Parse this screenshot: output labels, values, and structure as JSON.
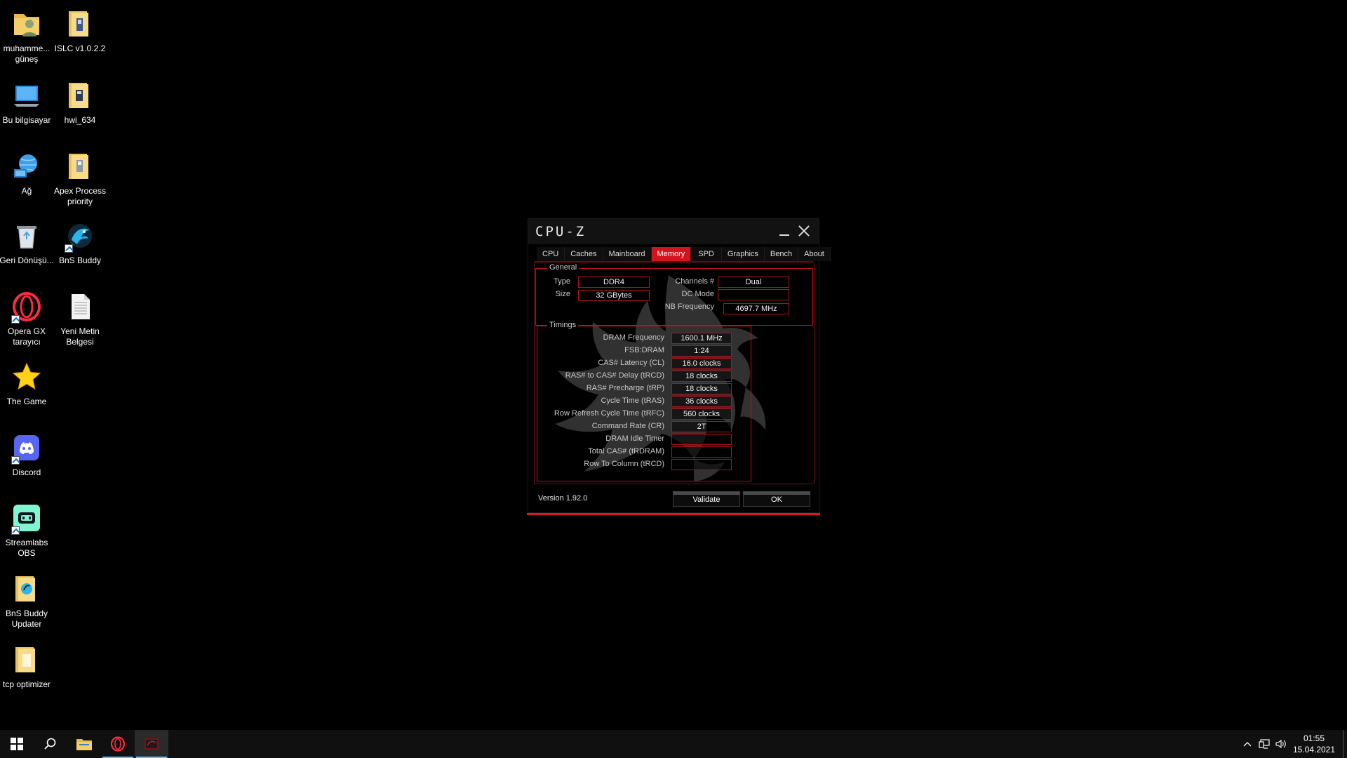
{
  "desktop": {
    "icons": [
      {
        "label": "muhamme... güneş",
        "icon": "user-folder-icon"
      },
      {
        "label": "ISLC v1.0.2.2",
        "icon": "folder-icon"
      },
      {
        "label": "Bu bilgisayar",
        "icon": "computer-icon"
      },
      {
        "label": "hwi_634",
        "icon": "folder-icon"
      },
      {
        "label": "Ağ",
        "icon": "network-icon"
      },
      {
        "label": "Apex Process priority",
        "icon": "folder-icon"
      },
      {
        "label": "Geri Dönüşü...",
        "icon": "recycle-bin-icon"
      },
      {
        "label": "BnS Buddy",
        "icon": "bns-buddy-icon"
      },
      {
        "label": "Opera GX tarayıcı",
        "icon": "opera-gx-icon"
      },
      {
        "label": "Yeni Metin Belgesi",
        "icon": "text-document-icon"
      },
      {
        "label": "The Game",
        "icon": "star-icon"
      },
      {
        "label": "Discord",
        "icon": "discord-icon"
      },
      {
        "label": "Streamlabs OBS",
        "icon": "streamlabs-obs-icon"
      },
      {
        "label": "BnS Buddy Updater",
        "icon": "folder-icon"
      },
      {
        "label": "tcp optimizer",
        "icon": "folder-icon"
      }
    ]
  },
  "cpuz": {
    "title": "CPU-Z",
    "tabs": [
      "CPU",
      "Caches",
      "Mainboard",
      "Memory",
      "SPD",
      "Graphics",
      "Bench",
      "About"
    ],
    "active_tab": "Memory",
    "general": {
      "title": "General",
      "type_label": "Type",
      "type_value": "DDR4",
      "size_label": "Size",
      "size_value": "32 GBytes",
      "channels_label": "Channels #",
      "channels_value": "Dual",
      "dc_mode_label": "DC Mode",
      "dc_mode_value": "",
      "nb_freq_label": "NB Frequency",
      "nb_freq_value": "4697.7 MHz"
    },
    "timings": {
      "title": "Timings",
      "rows": [
        {
          "label": "DRAM Frequency",
          "value": "1600.1 MHz"
        },
        {
          "label": "FSB:DRAM",
          "value": "1:24"
        },
        {
          "label": "CAS# Latency (CL)",
          "value": "16.0 clocks"
        },
        {
          "label": "RAS# to CAS# Delay (tRCD)",
          "value": "18 clocks"
        },
        {
          "label": "RAS# Precharge (tRP)",
          "value": "18 clocks"
        },
        {
          "label": "Cycle Time (tRAS)",
          "value": "36 clocks"
        },
        {
          "label": "Row Refresh Cycle Time (tRFC)",
          "value": "560 clocks"
        },
        {
          "label": "Command Rate (CR)",
          "value": "2T"
        },
        {
          "label": "DRAM Idle Timer",
          "value": ""
        },
        {
          "label": "Total CAS# (tRDRAM)",
          "value": ""
        },
        {
          "label": "Row To Column (tRCD)",
          "value": ""
        }
      ]
    },
    "version": "Version 1.92.0",
    "validate_label": "Validate",
    "ok_label": "OK",
    "accent_color": "#d4141c"
  },
  "taskbar": {
    "time": "01:55",
    "date": "15.04.2021",
    "pinned": [
      "start-icon",
      "search-icon",
      "file-explorer-icon",
      "opera-gx-icon",
      "cpuz-app-icon"
    ]
  }
}
